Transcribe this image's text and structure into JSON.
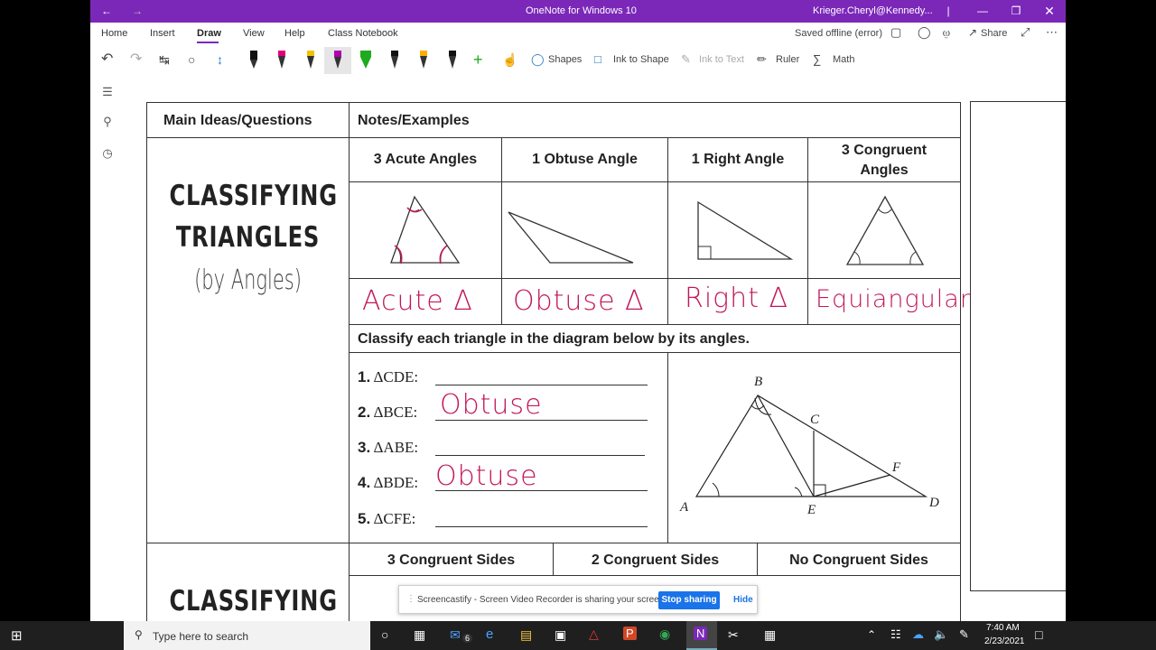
{
  "titlebar": {
    "title": "OneNote for Windows 10",
    "account": "Krieger.Cheryl@Kennedy..."
  },
  "menu": {
    "items": [
      "Home",
      "Insert",
      "Draw",
      "View",
      "Help",
      "Class Notebook"
    ],
    "active": "Draw",
    "status": "Saved offline (error)",
    "share": "Share"
  },
  "toolbar": {
    "shapes": "Shapes",
    "ink_to_shape": "Ink to Shape",
    "ink_to_text": "Ink to Text",
    "ruler": "Ruler",
    "math": "Math"
  },
  "note": {
    "headers": {
      "left": "Main Ideas/Questions",
      "right": "Notes/Examples"
    },
    "section1": {
      "title1": "CLASSIFYING",
      "title2": "TRIANGLES",
      "subtitle": "(by Angles)"
    },
    "angle_cols": [
      "3 Acute Angles",
      "1 Obtuse Angle",
      "1 Right Angle",
      "3 Congruent Angles"
    ],
    "handwritten_names": [
      "Acute Δ",
      "Obtuse Δ",
      "Right Δ",
      "Equiangular"
    ],
    "instruction": "Classify each triangle in the diagram below by its angles.",
    "questions": [
      {
        "num": "1.",
        "label": "ΔCDE:",
        "answer": ""
      },
      {
        "num": "2.",
        "label": "ΔBCE:",
        "answer": "Obtuse"
      },
      {
        "num": "3.",
        "label": "ΔABE:",
        "answer": ""
      },
      {
        "num": "4.",
        "label": "ΔBDE:",
        "answer": "Obtuse"
      },
      {
        "num": "5.",
        "label": "ΔCFE:",
        "answer": ""
      }
    ],
    "diagram_labels": {
      "A": "A",
      "B": "B",
      "C": "C",
      "D": "D",
      "E": "E",
      "F": "F"
    },
    "section2": {
      "title1": "CLASSIFYING"
    },
    "side_cols": [
      "3 Congruent Sides",
      "2 Congruent Sides",
      "No Congruent Sides"
    ]
  },
  "notification": {
    "text": "Screencastify - Screen Video Recorder is sharing your screen.",
    "stop": "Stop sharing",
    "hide": "Hide"
  },
  "taskbar": {
    "search_placeholder": "Type here to search",
    "time": "7:40 AM",
    "date": "2/23/2021",
    "mail_badge": "6"
  },
  "colors": {
    "titlebar": "#7b28b9",
    "ink": "#c2185b",
    "accent": "#1a73e8"
  }
}
